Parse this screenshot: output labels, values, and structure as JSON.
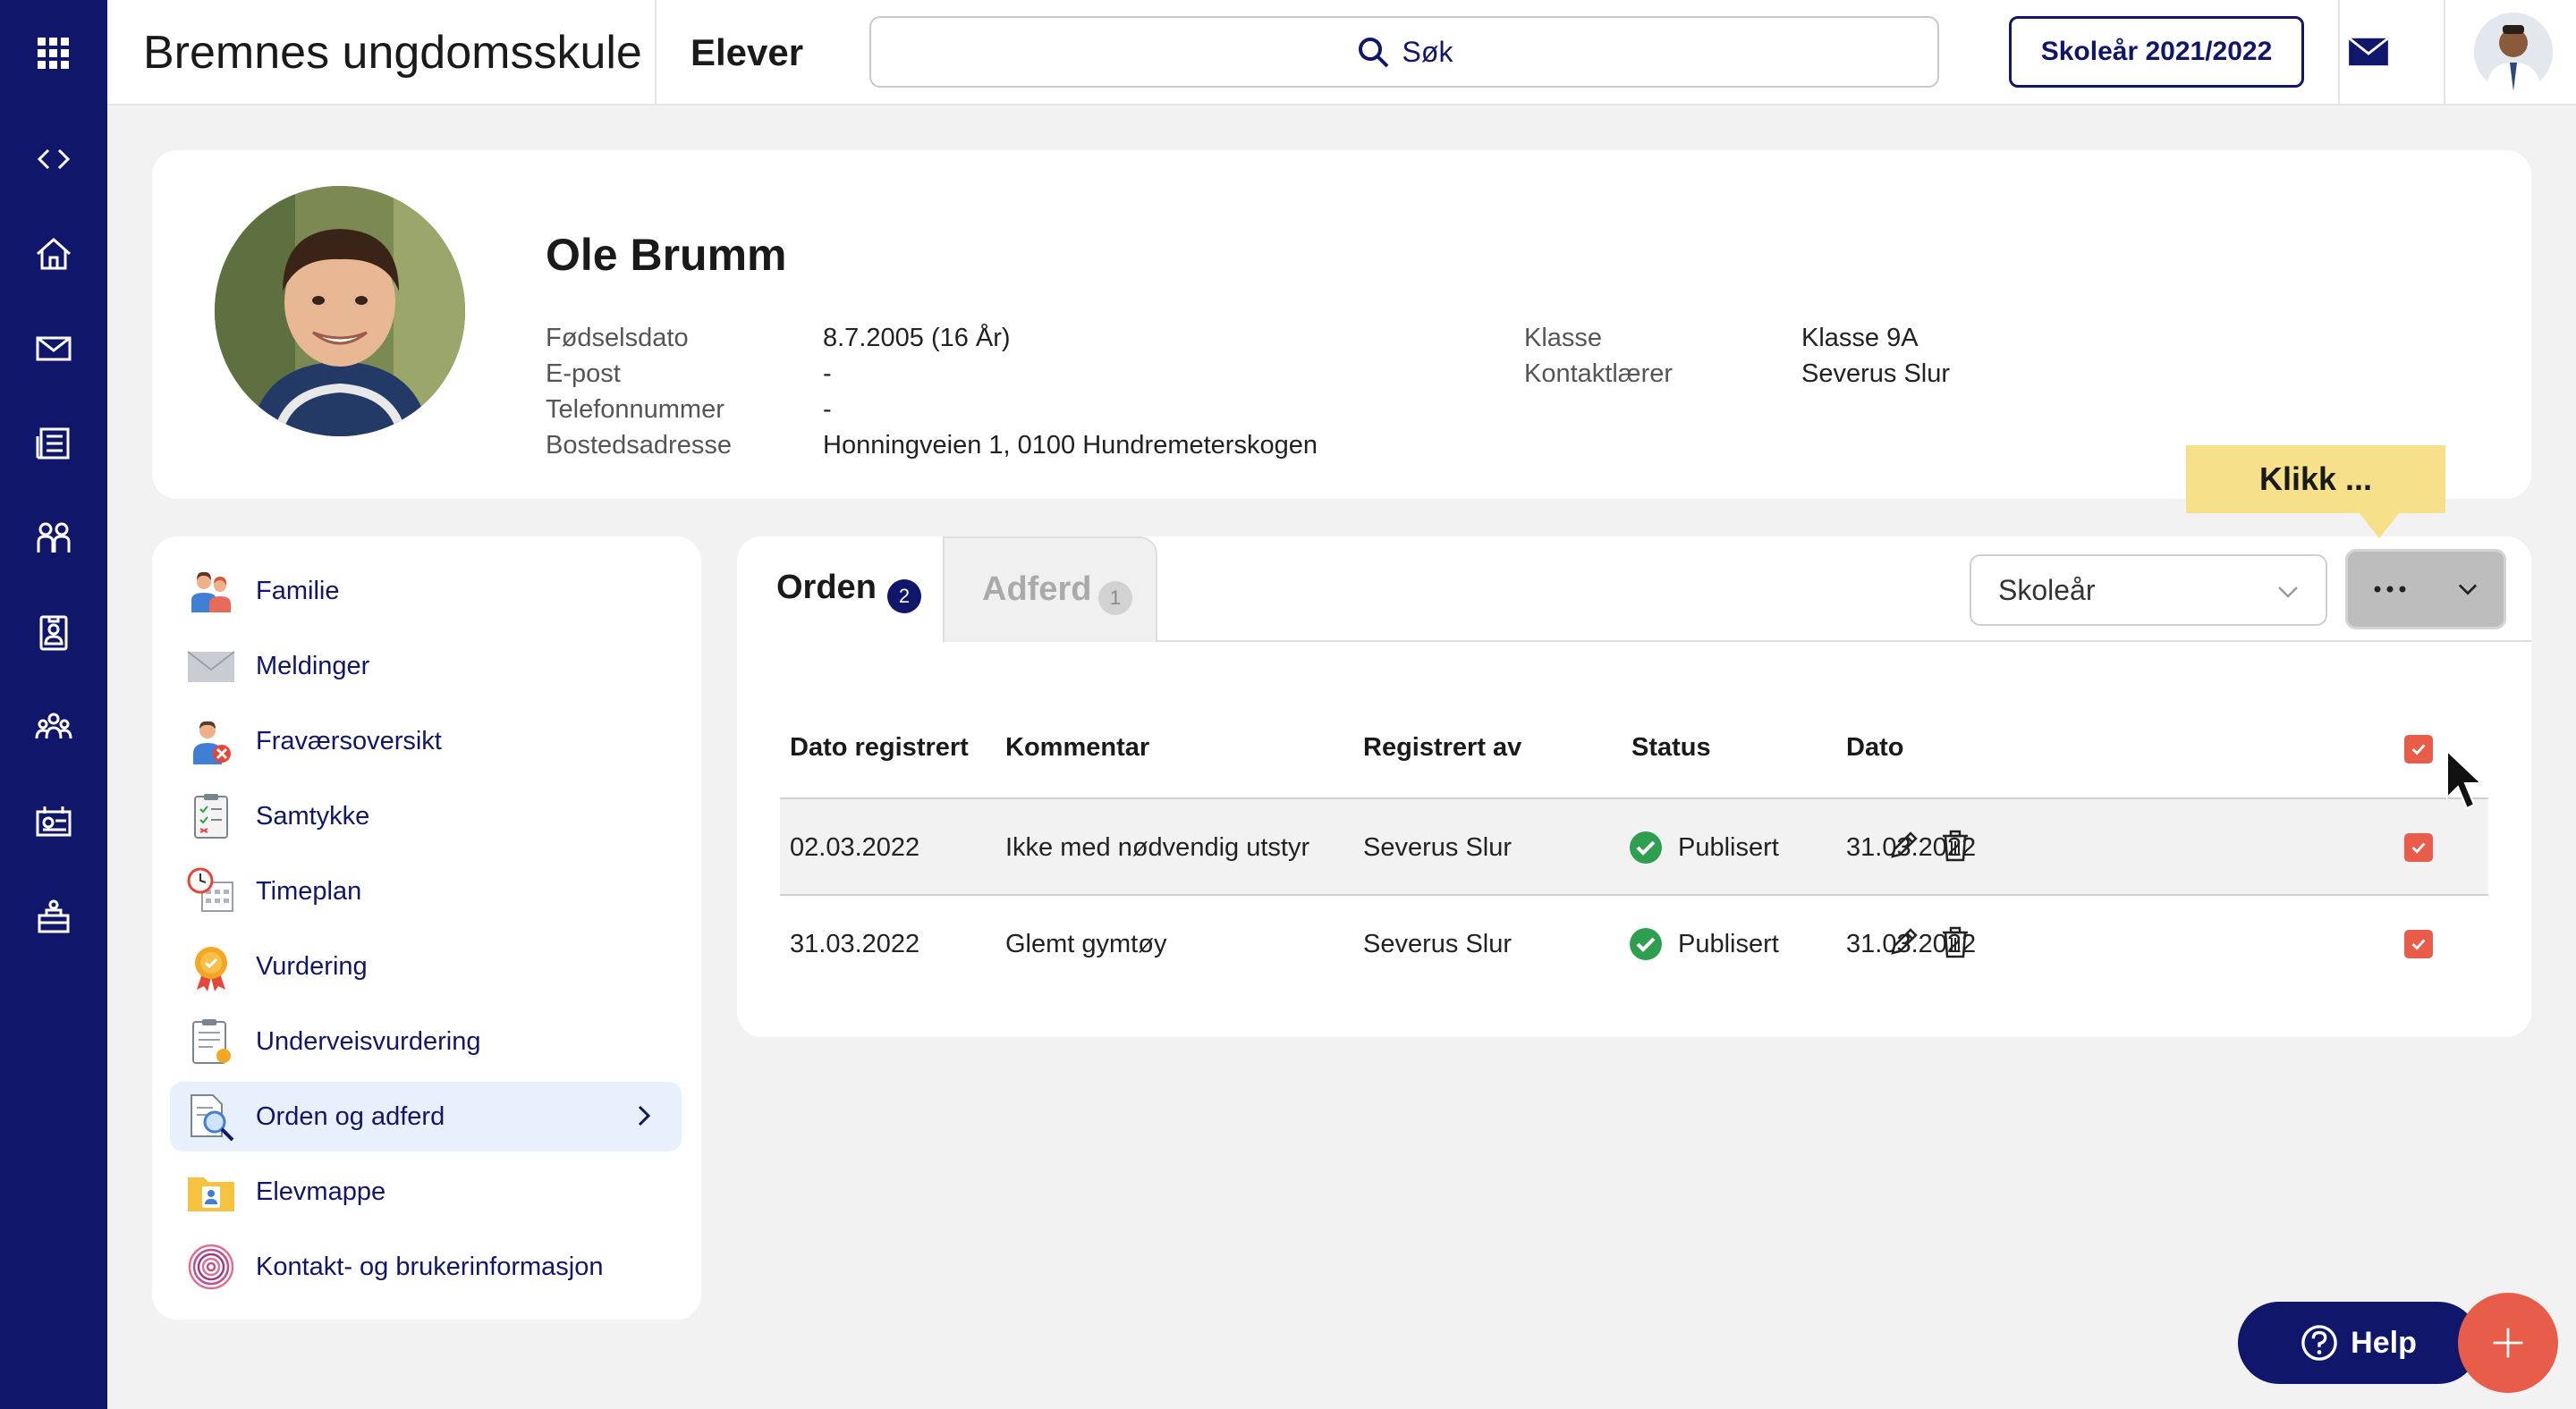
{
  "header": {
    "school_name": "Bremnes ungdomsskule",
    "section": "Elever",
    "search_label": "Søk",
    "school_year_button": "Skoleår 2021/2022"
  },
  "sidebar": {
    "icons": [
      "apps-grid-icon",
      "code-toggle-icon",
      "home-icon",
      "mail-icon",
      "news-icon",
      "people-icon",
      "id-badge-icon",
      "group-icon",
      "calendar-board-icon",
      "desk-icon"
    ]
  },
  "profile": {
    "name": "Ole Brumm",
    "fields_left": [
      {
        "label": "Fødselsdato",
        "value": "8.7.2005 (16 År)"
      },
      {
        "label": "E-post",
        "value": "-"
      },
      {
        "label": "Telefonnummer",
        "value": "-"
      },
      {
        "label": "Bostedsadresse",
        "value": "Honningveien 1, 0100 Hundremeterskogen"
      }
    ],
    "fields_right": [
      {
        "label": "Klasse",
        "value": "Klasse 9A"
      },
      {
        "label": "Kontaktlærer",
        "value": "Severus Slur"
      }
    ]
  },
  "nav": {
    "items": [
      {
        "label": "Familie",
        "icon": "family-icon"
      },
      {
        "label": "Meldinger",
        "icon": "envelope-icon"
      },
      {
        "label": "Fraværsoversikt",
        "icon": "absence-icon"
      },
      {
        "label": "Samtykke",
        "icon": "consent-checklist-icon"
      },
      {
        "label": "Timeplan",
        "icon": "schedule-icon"
      },
      {
        "label": "Vurdering",
        "icon": "medal-icon"
      },
      {
        "label": "Underveisvurdering",
        "icon": "clipboard-icon"
      },
      {
        "label": "Orden og adferd",
        "icon": "document-search-icon",
        "active": true
      },
      {
        "label": "Elevmappe",
        "icon": "folder-icon"
      },
      {
        "label": "Kontakt- og brukerinformasjon",
        "icon": "fingerprint-icon"
      }
    ]
  },
  "main": {
    "tabs": [
      {
        "label": "Orden",
        "count": "2",
        "active": true
      },
      {
        "label": "Adferd",
        "count": "1",
        "active": false
      }
    ],
    "filter_select": "Skoleår",
    "more_button": "...",
    "table": {
      "headers": [
        "Dato registrert",
        "Kommentar",
        "Registrert av",
        "Status",
        "Dato"
      ],
      "rows": [
        {
          "registered": "02.03.2022",
          "comment": "Ikke med nødvendig utstyr",
          "by": "Severus Slur",
          "status": "Publisert",
          "date": "31.03.2022"
        },
        {
          "registered": "31.03.2022",
          "comment": "Glemt gymtøy",
          "by": "Severus Slur",
          "status": "Publisert",
          "date": "31.03.2022"
        }
      ]
    }
  },
  "callout": "Klikk ...",
  "help_button": "Help",
  "colors": {
    "navy": "#10166a",
    "accent_red": "#e85c4a",
    "status_green": "#2e9e4f",
    "callout_yellow": "#f7e08a"
  }
}
